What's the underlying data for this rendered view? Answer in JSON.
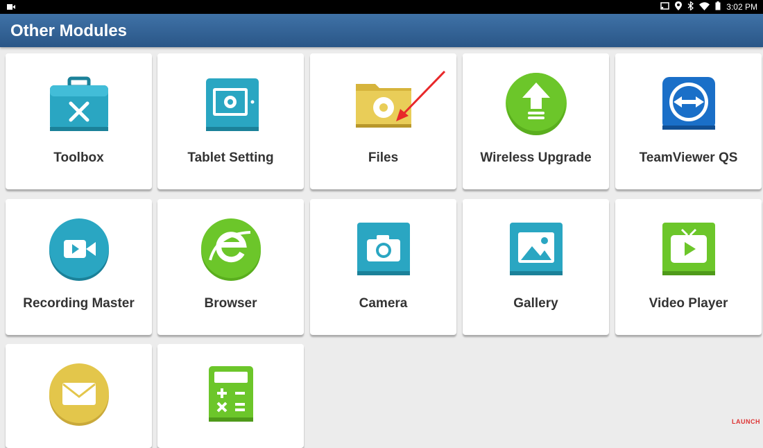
{
  "status_bar": {
    "time": "3:02 PM",
    "icons": [
      "video-camera-icon",
      "screen-cast-icon",
      "location-pin-icon",
      "bluetooth-icon",
      "wifi-icon",
      "battery-icon"
    ]
  },
  "header": {
    "title": "Other Modules"
  },
  "modules": [
    {
      "label": "Toolbox",
      "icon": "toolbox-icon",
      "color": "#2aa6c2"
    },
    {
      "label": "Tablet Setting",
      "icon": "tablet-settings-icon",
      "color": "#2aa6c2"
    },
    {
      "label": "Files",
      "icon": "folder-gear-icon",
      "color": "#e3c64b"
    },
    {
      "label": "Wireless Upgrade",
      "icon": "upload-arrow-icon",
      "color": "#6cc62a"
    },
    {
      "label": "TeamViewer QS",
      "icon": "teamviewer-icon",
      "color": "#1a6fc8"
    },
    {
      "label": "Recording Master",
      "icon": "video-record-icon",
      "color": "#2aa6c2"
    },
    {
      "label": "Browser",
      "icon": "internet-browser-icon",
      "color": "#6cc62a"
    },
    {
      "label": "Camera",
      "icon": "camera-icon",
      "color": "#2aa6c2"
    },
    {
      "label": "Gallery",
      "icon": "gallery-image-icon",
      "color": "#2aa6c2"
    },
    {
      "label": "Video Player",
      "icon": "tv-play-icon",
      "color": "#6cc62a"
    },
    {
      "label": "",
      "icon": "mail-envelope-icon",
      "color": "#e3c64b"
    },
    {
      "label": "",
      "icon": "calculator-icon",
      "color": "#6cc62a"
    }
  ],
  "watermark": "LAUNCH"
}
